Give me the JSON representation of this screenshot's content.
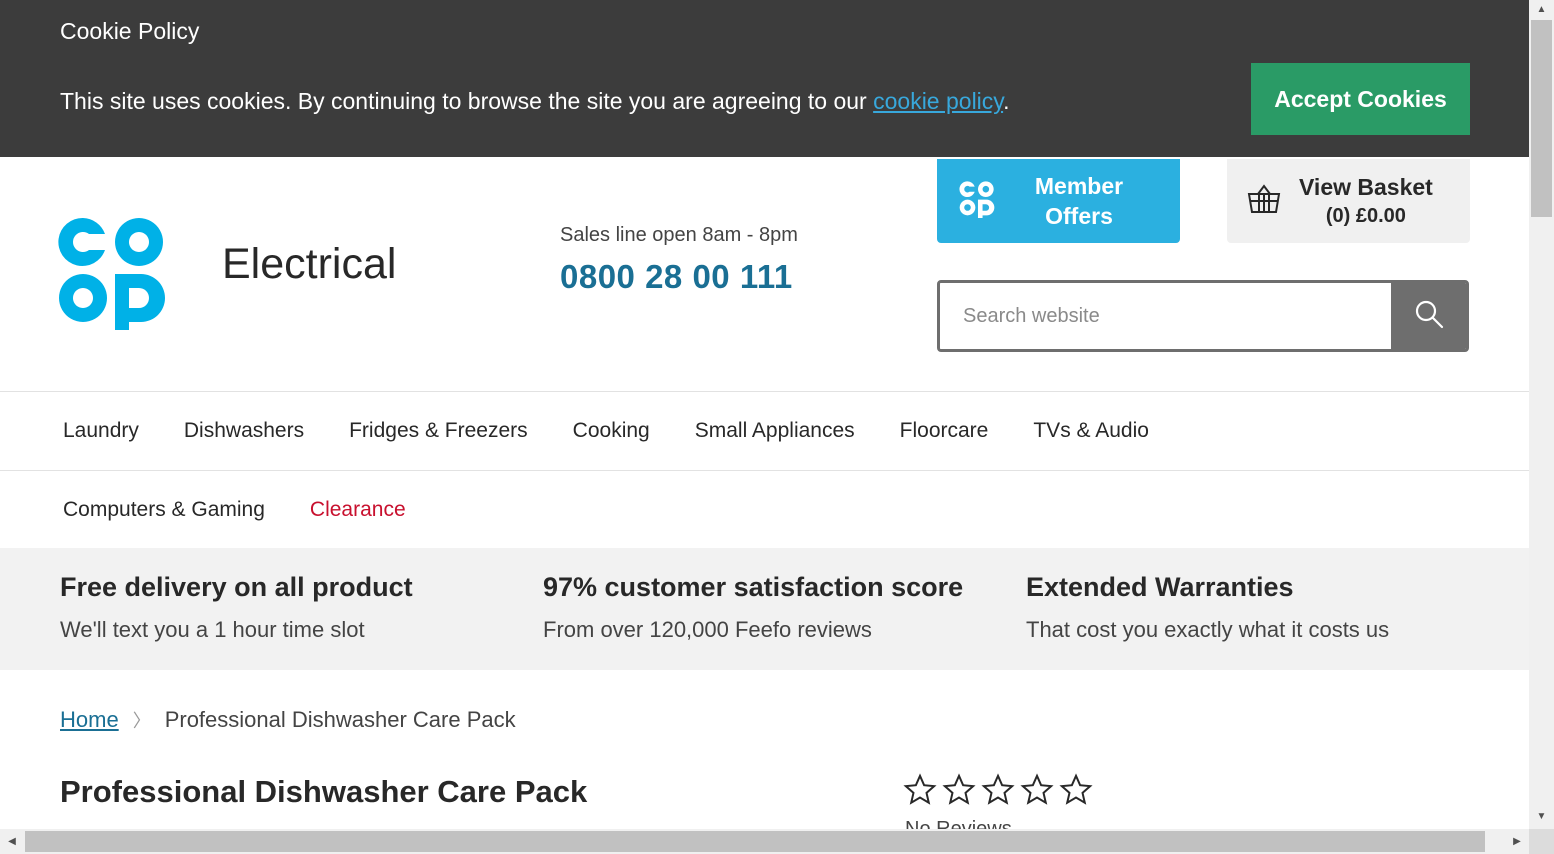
{
  "cookie_banner": {
    "title": "Cookie Policy",
    "text_before": "This site uses cookies. By continuing to browse the site you are agreeing to our ",
    "link_text": "cookie policy",
    "text_after": ".",
    "accept_label": "Accept Cookies"
  },
  "header": {
    "logo_text": "co op",
    "site_name": "Electrical",
    "sales_line": "Sales line open 8am - 8pm",
    "phone": "0800 28 00 111",
    "member_offers_label": "Member Offers",
    "basket": {
      "title": "View Basket",
      "summary": "(0) £0.00"
    },
    "search": {
      "placeholder": "Search website",
      "value": ""
    }
  },
  "nav": {
    "row1": [
      "Laundry",
      "Dishwashers",
      "Fridges & Freezers",
      "Cooking",
      "Small Appliances",
      "Floorcare",
      "TVs & Audio"
    ],
    "row2": [
      "Computers & Gaming",
      "Clearance"
    ]
  },
  "usps": [
    {
      "title": "Free delivery on all product",
      "subtitle": "We'll text you a 1 hour time slot"
    },
    {
      "title": "97% customer satisfaction score",
      "subtitle": "From over 120,000 Feefo reviews"
    },
    {
      "title": "Extended Warranties",
      "subtitle": "That cost you exactly what it costs us"
    }
  ],
  "breadcrumb": {
    "home": "Home",
    "separator": "〉",
    "current": "Professional Dishwasher Care Pack"
  },
  "product": {
    "title": "Professional Dishwasher Care Pack",
    "rating": 0,
    "rating_max": 5,
    "reviews_text": "No Reviews"
  },
  "colors": {
    "cookie_bg": "#3c3c3c",
    "accept_green": "#2a9b66",
    "coop_blue": "#00b1e7",
    "member_blue": "#2bb0e0",
    "phone_blue": "#1a6f94",
    "clearance_red": "#c8102e"
  },
  "icons": {
    "logo": "coop-logo-icon",
    "basket": "basket-icon",
    "search": "search-icon",
    "star": "star-outline-icon"
  }
}
